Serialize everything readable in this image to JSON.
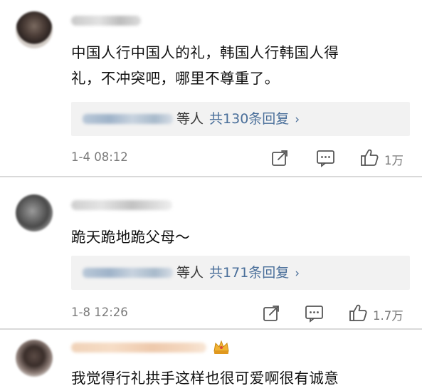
{
  "comments": [
    {
      "text_line1": "中国人行中国人的礼，韩国人行韩国人得",
      "text_line2": "礼，不冲突吧，哪里不尊重了。",
      "reply_suffix": "等人",
      "reply_count": "共130条回复",
      "reply_arrow": "›",
      "time": "1-4 08:12",
      "likes": "1万"
    },
    {
      "text_line1": "跪天跪地跪父母～",
      "reply_suffix": "等人",
      "reply_count": "共171条回复",
      "reply_arrow": "›",
      "time": "1-8 12:26",
      "likes": "1.7万"
    },
    {
      "text_line1": "我觉得行礼拱手这样也很可爱啊很有诚意"
    }
  ],
  "icons": {
    "share": "share-icon",
    "comment": "comment-icon",
    "like": "thumbs-up-icon",
    "badge": "crown-icon"
  },
  "colors": {
    "reply_link": "#4a6f9a",
    "meta_text": "#7a7a7a",
    "separator": "#d9d9d9",
    "reply_bg": "#f2f2f2"
  }
}
